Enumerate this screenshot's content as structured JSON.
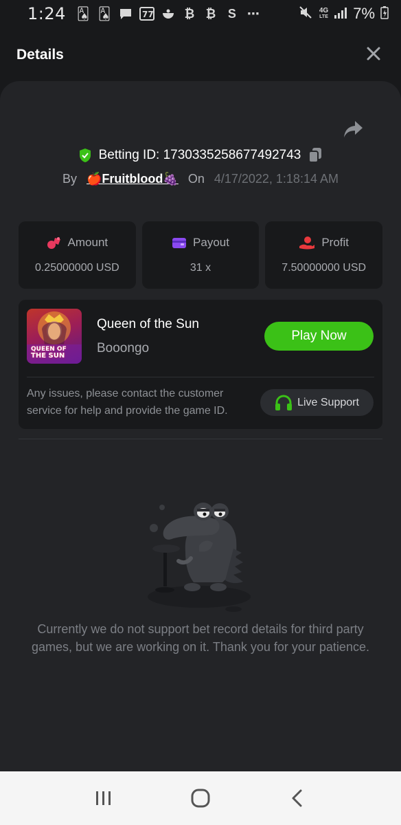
{
  "status_bar": {
    "time": "1:24",
    "battery": "7%",
    "network": "4G",
    "network_sub": "LTE"
  },
  "header": {
    "title": "Details"
  },
  "bet": {
    "betting_id_label": "Betting ID: 1730335258677492743",
    "by_label": "By",
    "username": "🍎Fruitblood🍇",
    "on_label": "On",
    "date": "4/17/2022, 1:18:14 AM"
  },
  "stats": [
    {
      "label": "Amount",
      "value": "0.25000000 USD",
      "icon": "coins-icon",
      "color": "#e8395e"
    },
    {
      "label": "Payout",
      "value": "31 x",
      "icon": "wallet-icon",
      "color": "#8a49f0"
    },
    {
      "label": "Profit",
      "value": "7.50000000 USD",
      "icon": "hand-coin-icon",
      "color": "#e8393d"
    }
  ],
  "game": {
    "name": "Queen of the Sun",
    "provider": "Booongo",
    "thumb_title_line1": "QUEEN OF",
    "thumb_title_line2": "THE SUN",
    "play_label": "Play Now",
    "issue_text": "Any issues, please contact the customer service for help and provide the game ID.",
    "support_label": "Live Support"
  },
  "empty_state": {
    "message": "Currently we do not support bet record details for third party games, but we are working on it. Thank you for your patience."
  },
  "colors": {
    "accent_green": "#3bc117",
    "background": "#18191b",
    "panel": "#232427"
  }
}
